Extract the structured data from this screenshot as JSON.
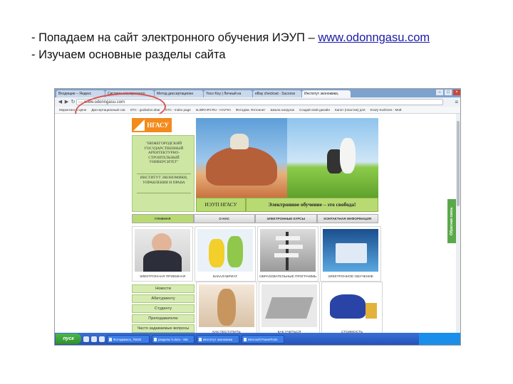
{
  "slide": {
    "line1_prefix": "- Попадаем на сайт электронного обучения ИЭУП – ",
    "line1_link": "www.odonngasu.com",
    "line2": "- Изучаем основные разделы сайта"
  },
  "browser": {
    "tabs": [
      "Входящие – Яндекс",
      "Система электронного",
      "Метод диссертационн",
      "Yoco Key | Личный ка",
      "eBay checkout - Success",
      "Институт экономики,"
    ],
    "address": "www.odonngasu.com",
    "bookmarks": [
      "Маркетинг в Цене",
      "Диссертационный сов",
      "STC - godsolon.sbar",
      "STC - Index page",
      "eLIBRARY.RU - НАУЧН",
      "Фотодом. Фотоннит",
      "Шкала нагрузок",
      "Создай свой дизайн",
      "Капот (пластик) для",
      "Krazy Kushons - Мой"
    ]
  },
  "site": {
    "logo_text": "НГАСУ",
    "university_name": "\"НИЖЕГОРОДСКИЙ ГОСУДАРСТВЕННЫЙ АРХИТЕКТУРНО-СТРОИТЕЛЬНЫЙ УНИВЕРСИТЕТ\"",
    "institute_name": "ИНСТИТУТ ЭКОНОМИКИ, УПРАВЛЕНИЯ И ПРАВА",
    "label_short": "ИЭУП НГАСУ",
    "label_slogan": "Электронное обучение – это свобода!",
    "nav": [
      "ГЛАВНАЯ",
      "О НАС",
      "ЭЛЕКТРОННЫЕ КУРСЫ",
      "КОНТАКТНАЯ ИНФОРМАЦИЯ"
    ],
    "cards_row1": [
      "ЭЛЕКТРОННАЯ ПРИЕМНАЯ",
      "БАКАЛАВРИАТ",
      "ОБРАЗОВАТЕЛЬНЫЕ ПРОГРАММЫ",
      "ЭЛЕКТРОННОЕ ОБУЧЕНИЕ"
    ],
    "cards_row2": [
      "КАК ПОСТУПИТЬ",
      "КАК УЧИТЬСЯ",
      "СТОИМОСТЬ"
    ],
    "menu": [
      "Новости",
      "Абитуриенту",
      "Студенту",
      "Преподавателю",
      "Часто задаваемые вопросы"
    ],
    "feedback": "Обратная связь"
  },
  "taskbar": {
    "start": "пуск",
    "items": [
      "Фотодвижок_75030",
      "разделы h.docx - Mic",
      "Институт экономики",
      "Microsoft PowerPoint"
    ],
    "clock": ""
  },
  "colors": {
    "accent_orange": "#f28a1c",
    "site_green": "#b8da73",
    "highlight_red": "#d9534f",
    "link_blue": "#1a1aa6"
  }
}
